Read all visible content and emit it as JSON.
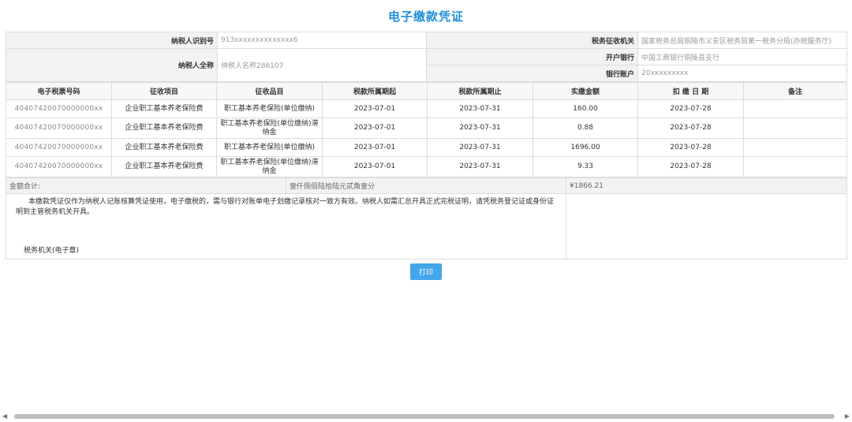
{
  "title": "电子缴款凭证",
  "taxpayer": {
    "id_label": "纳税人识别号",
    "id_value": "913xxxxxxxxxxxxxx6",
    "name_label": "纳税人全称",
    "name_value": "纳税人名称286107",
    "authority_label": "税务征收机关",
    "authority_value": "国家税务总局铜陵市义安区税务局第一税务分局(办税服务厅)",
    "bank_label": "开户银行",
    "bank_value": "中国工商银行铜陵县支行",
    "account_label": "银行账户",
    "account_value": "20xxxxxxxxx"
  },
  "table": {
    "headers": [
      "电子税票号码",
      "征收项目",
      "征收品目",
      "税款所属期起",
      "税款所属期止",
      "实缴金额",
      "扣 缴 日 期",
      "备注"
    ],
    "rows": [
      [
        "40407420070000000xx",
        "企业职工基本养老保险费",
        "职工基本养老保险(单位缴纳)",
        "2023-07-01",
        "2023-07-31",
        "160.00",
        "2023-07-28",
        ""
      ],
      [
        "40407420070000000xx",
        "企业职工基本养老保险费",
        "职工基本养老保险(单位缴纳)滞纳金",
        "2023-07-01",
        "2023-07-31",
        "0.88",
        "2023-07-28",
        ""
      ],
      [
        "40407420070000000xx",
        "企业职工基本养老保险费",
        "职工基本养老保险(单位缴纳)",
        "2023-07-01",
        "2023-07-31",
        "1696.00",
        "2023-07-28",
        ""
      ],
      [
        "40407420070000000xx",
        "企业职工基本养老保险费",
        "职工基本养老保险(单位缴纳)滞纳金",
        "2023-07-01",
        "2023-07-31",
        "9.33",
        "2023-07-28",
        ""
      ]
    ]
  },
  "total": {
    "label": "金额合计:",
    "in_words": "壹仟捌佰陆拾陆元贰角壹分",
    "amount": "¥1866.21"
  },
  "note": {
    "text": "本缴款凭证仅作为纳税人记账核算凭证使用，电子缴税的，需与银行对账单电子划缴记录核对一致方有效。纳税人如需汇总开具正式完税证明，请凭税务登记证或身份证明到主管税务机关开具。",
    "seal": "税务机关(电子章)"
  },
  "print_label": "打印",
  "scrollbar": {
    "left_icon": "◀",
    "right_icon": "▶"
  }
}
